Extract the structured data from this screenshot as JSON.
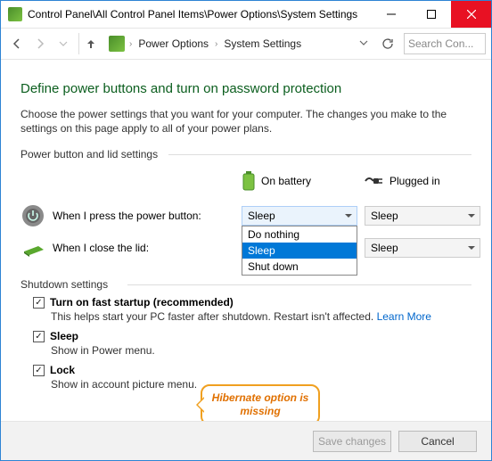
{
  "title": "Control Panel\\All Control Panel Items\\Power Options\\System Settings",
  "breadcrumb": {
    "seg1": "Power Options",
    "seg2": "System Settings"
  },
  "search": {
    "placeholder": "Search Con..."
  },
  "heading": "Define power buttons and turn on password protection",
  "intro": "Choose the power settings that you want for your computer. The changes you make to the settings on this page apply to all of your power plans.",
  "group1": "Power button and lid settings",
  "col_battery": "On battery",
  "col_plugged": "Plugged in",
  "row_power_button": "When I press the power button:",
  "row_lid": "When I close the lid:",
  "combo": {
    "power_battery": "Sleep",
    "power_plugged": "Sleep",
    "lid_plugged": "Sleep",
    "options": [
      "Do nothing",
      "Sleep",
      "Shut down"
    ]
  },
  "group2": "Shutdown settings",
  "shutdown": [
    {
      "label": "Turn on fast startup (recommended)",
      "desc": "This helps start your PC faster after shutdown. Restart isn't affected. ",
      "link": "Learn More"
    },
    {
      "label": "Sleep",
      "desc": "Show in Power menu."
    },
    {
      "label": "Lock",
      "desc": "Show in account picture menu."
    }
  ],
  "callout": "Hibernate option is missing",
  "footer": {
    "save": "Save changes",
    "cancel": "Cancel"
  }
}
